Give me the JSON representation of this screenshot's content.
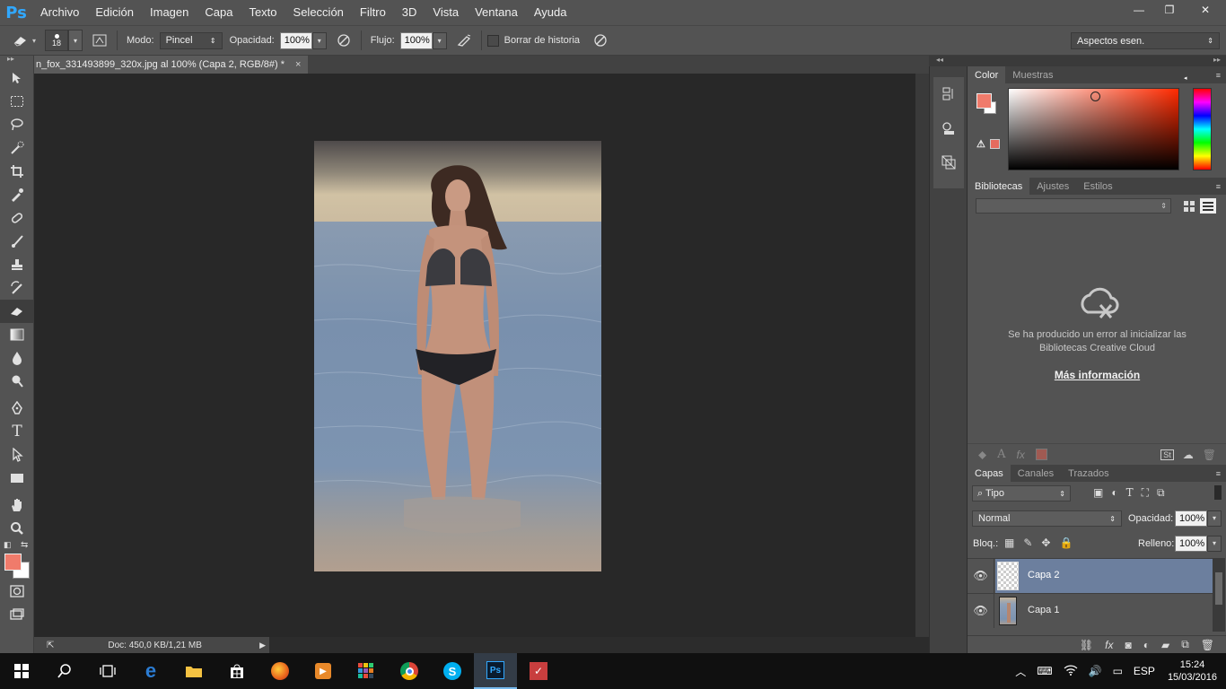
{
  "app": {
    "logo": "Ps",
    "menu": [
      "Archivo",
      "Edición",
      "Imagen",
      "Capa",
      "Texto",
      "Selección",
      "Filtro",
      "3D",
      "Vista",
      "Ventana",
      "Ayuda"
    ],
    "window_controls": {
      "minimize": "—",
      "restore": "❐",
      "close": "✕"
    }
  },
  "options": {
    "brush_size": "18",
    "mode_label": "Modo:",
    "mode_value": "Pincel",
    "opacity_label": "Opacidad:",
    "opacity_value": "100%",
    "flow_label": "Flujo:",
    "flow_value": "100%",
    "erase_history_label": "Borrar de historia",
    "workspace": "Aspectos esen."
  },
  "document": {
    "tab_title": "n_fox_331493899_320x.jpg al 100% (Capa 2, RGB/8#) *",
    "tab_close": "×",
    "status": "Doc: 450,0 KB/1,21 MB"
  },
  "color_panel": {
    "tabs": [
      "Color",
      "Muestras"
    ],
    "foreground": "#f07b6b",
    "background": "#ffffff"
  },
  "libraries_panel": {
    "tabs": [
      "Bibliotecas",
      "Ajustes",
      "Estilos"
    ],
    "error_line1": "Se ha producido un error al inicializar las",
    "error_line2": "Bibliotecas Creative Cloud",
    "more_info": "Más información"
  },
  "layers_panel": {
    "tabs": [
      "Capas",
      "Canales",
      "Trazados"
    ],
    "filter": "Tipo",
    "blend_mode": "Normal",
    "opacity_label": "Opacidad:",
    "opacity_value": "100%",
    "lock_label": "Bloq.:",
    "fill_label": "Relleno:",
    "fill_value": "100%",
    "layers": [
      {
        "name": "Capa 2",
        "selected": true
      },
      {
        "name": "Capa 1",
        "selected": false
      }
    ]
  },
  "taskbar": {
    "language": "ESP",
    "time": "15:24",
    "date": "15/03/2016"
  },
  "colors": {
    "accent_ps": "#31a8ff",
    "selected_layer": "#6c7f9e"
  }
}
